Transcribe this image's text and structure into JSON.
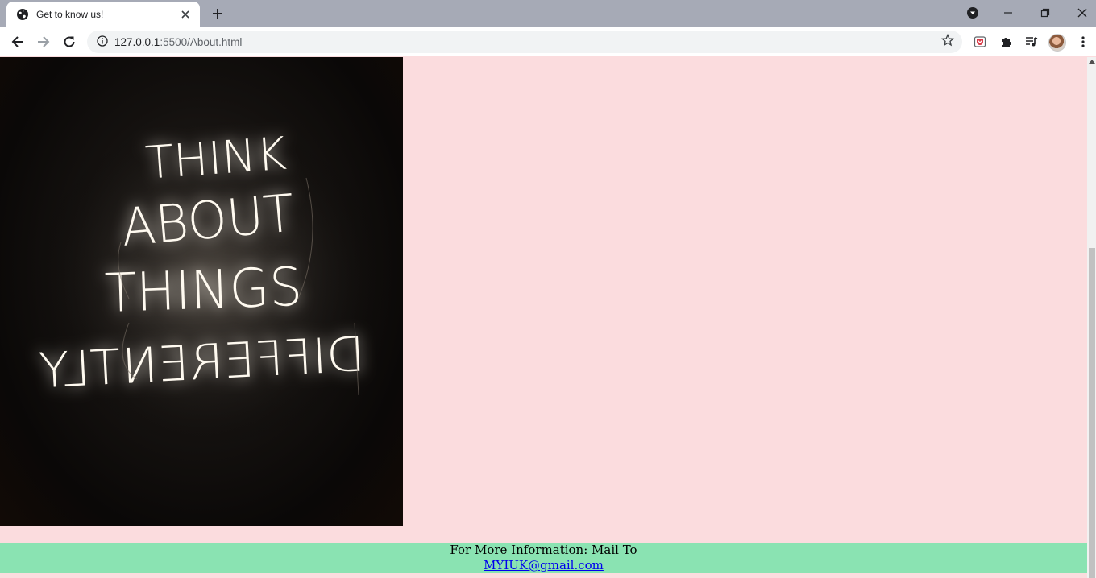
{
  "browser": {
    "tab_title": "Get to know us!",
    "url_host": "127.0.0.1",
    "url_path": ":5500/About.html"
  },
  "page": {
    "image": {
      "lines": [
        "THINK",
        "ABOUT",
        "THINGS",
        "DIFFERENTLY"
      ],
      "mirrored_line": "DIFFERENTLY"
    },
    "footer": {
      "text": "For More Information: Mail To",
      "email": "MYIUK@gmail.com"
    }
  },
  "colors": {
    "page_background": "#fbdcde",
    "footer_background": "#8ae3b2",
    "link": "#0000ee"
  }
}
